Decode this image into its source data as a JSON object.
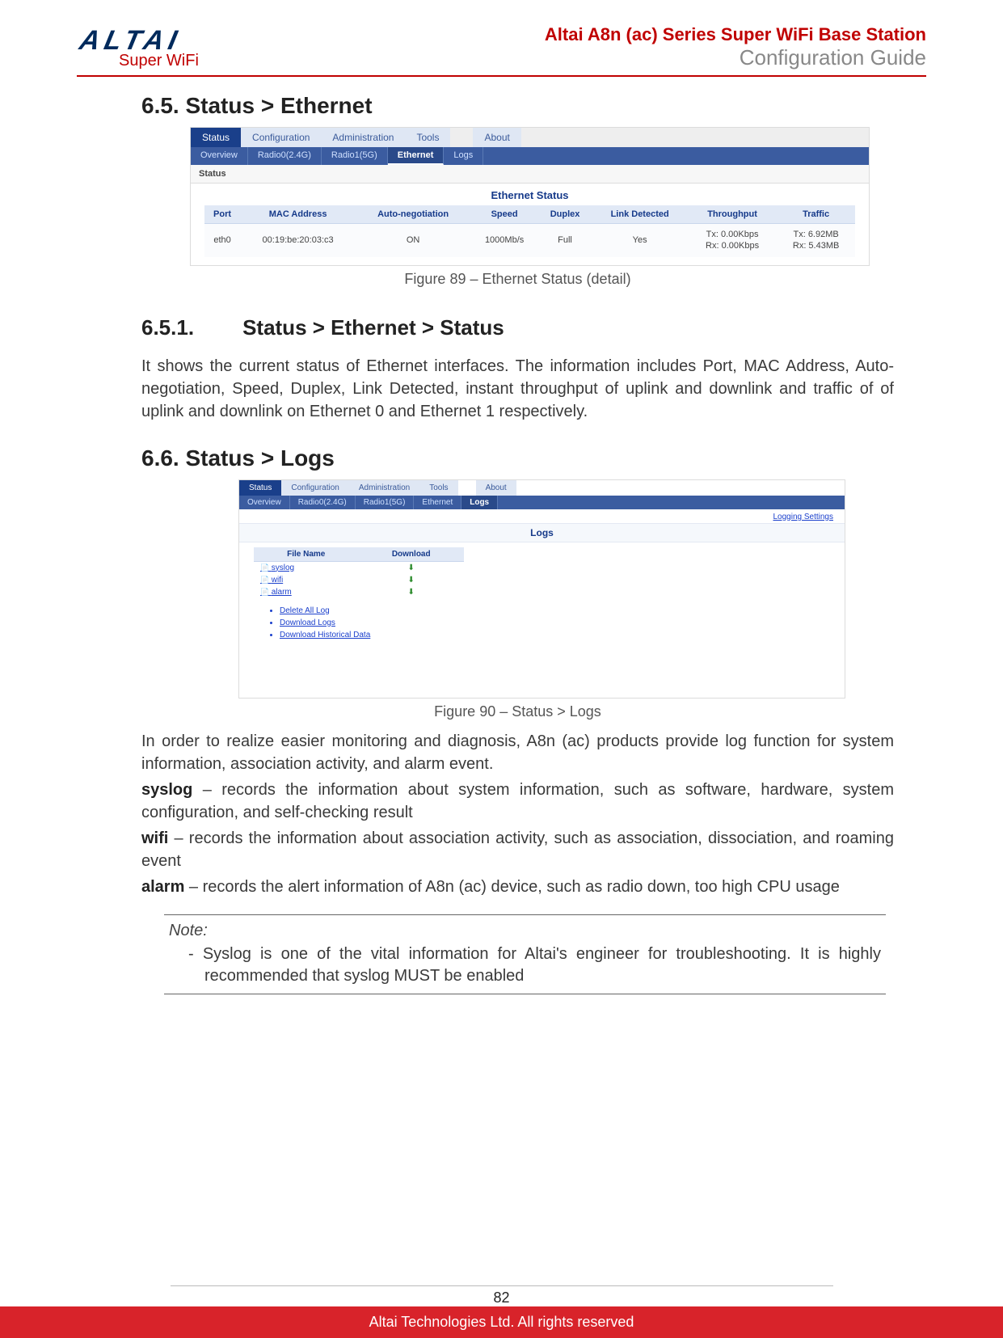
{
  "header": {
    "logo_main": "ALTAI",
    "logo_sub": "Super WiFi",
    "title_line1": "Altai A8n (ac) Series Super WiFi Base Station",
    "title_line2": "Configuration Guide"
  },
  "section1": {
    "heading": "6.5. Status > Ethernet",
    "caption": "Figure 89 – Ethernet Status (detail)"
  },
  "shot1": {
    "main_tabs": [
      "Status",
      "Configuration",
      "Administration",
      "Tools",
      "About"
    ],
    "sub_tabs": [
      "Overview",
      "Radio0(2.4G)",
      "Radio1(5G)",
      "Ethernet",
      "Logs"
    ],
    "sub_active_index": 3,
    "panel_label": "Status",
    "section_title": "Ethernet Status",
    "cols": [
      "Port",
      "MAC Address",
      "Auto-negotiation",
      "Speed",
      "Duplex",
      "Link Detected",
      "Throughput",
      "Traffic"
    ],
    "row": {
      "port": "eth0",
      "mac": "00:19:be:20:03:c3",
      "autoneg": "ON",
      "speed": "1000Mb/s",
      "duplex": "Full",
      "link": "Yes",
      "tp1": "Tx: 0.00Kbps",
      "tp2": "Rx: 0.00Kbps",
      "tr1": "Tx: 6.92MB",
      "tr2": "Rx: 5.43MB"
    }
  },
  "section2": {
    "num": "6.5.1.",
    "heading": "Status > Ethernet > Status",
    "para": "It shows the current status of Ethernet interfaces. The information includes Port, MAC Address, Auto-negotiation, Speed, Duplex, Link Detected, instant throughput of uplink and downlink and traffic of of uplink and downlink on Ethernet 0 and Ethernet 1 respectively."
  },
  "section3": {
    "heading": "6.6. Status > Logs",
    "caption": "Figure 90 – Status > Logs",
    "para_intro": "In order to realize easier monitoring and diagnosis, A8n (ac) products provide log function for system information, association activity, and alarm event.",
    "syslog_b": "syslog",
    "syslog_t": " – records the information about system information, such as software, hardware, system configuration, and self-checking result",
    "wifi_b": "wifi",
    "wifi_t": " – records the information about association activity, such as association,  dissociation, and roaming event",
    "alarm_b": "alarm",
    "alarm_t": " – records the alert information of A8n (ac) device, such as radio down, too high CPU usage"
  },
  "shot2": {
    "main_tabs": [
      "Status",
      "Configuration",
      "Administration",
      "Tools",
      "About"
    ],
    "sub_tabs": [
      "Overview",
      "Radio0(2.4G)",
      "Radio1(5G)",
      "Ethernet",
      "Logs"
    ],
    "sub_active_index": 4,
    "top_link": "Logging Settings",
    "section_title": "Logs",
    "cols": [
      "File Name",
      "Download"
    ],
    "rows": [
      {
        "name": "syslog",
        "dl": "⬇"
      },
      {
        "name": "wifi",
        "dl": "⬇"
      },
      {
        "name": "alarm",
        "dl": "⬇"
      }
    ],
    "links": [
      "Delete All Log",
      "Download Logs",
      "Download Historical Data"
    ]
  },
  "note": {
    "label": "Note:",
    "item": "Syslog is one of the vital information for Altai's engineer for troubleshooting. It is highly recommended that syslog MUST be enabled"
  },
  "footer": {
    "page": "82",
    "copyright": "Altai Technologies Ltd. All rights reserved"
  }
}
